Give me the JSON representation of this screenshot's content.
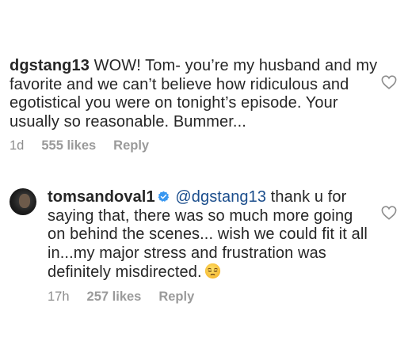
{
  "comments": [
    {
      "username": "dgstang13",
      "text": "WOW! Tom- you’re my husband and my favorite and we can’t believe how ridiculous and egotistical you were on tonight’s episode. Your usually so reasonable. Bummer...",
      "time": "1d",
      "likes": "555 likes",
      "reply_label": "Reply",
      "like_icon": "heart-outline-icon"
    },
    {
      "username": "tomsandoval1",
      "verified": true,
      "verified_icon": "verified-badge-icon",
      "mention": "@dgstang13",
      "text": "thank u for saying that, there was so much more going on behind the scenes... wish we could fit it all in...my major stress and frustration was definitely misdirected.",
      "emoji": "pensive-face-emoji",
      "time": "17h",
      "likes": "257 likes",
      "reply_label": "Reply",
      "like_icon": "heart-outline-icon"
    }
  ],
  "colors": {
    "text": "#262626",
    "meta": "#8e8e8e",
    "mention": "#1a4d8c",
    "verified": "#3897f0"
  }
}
